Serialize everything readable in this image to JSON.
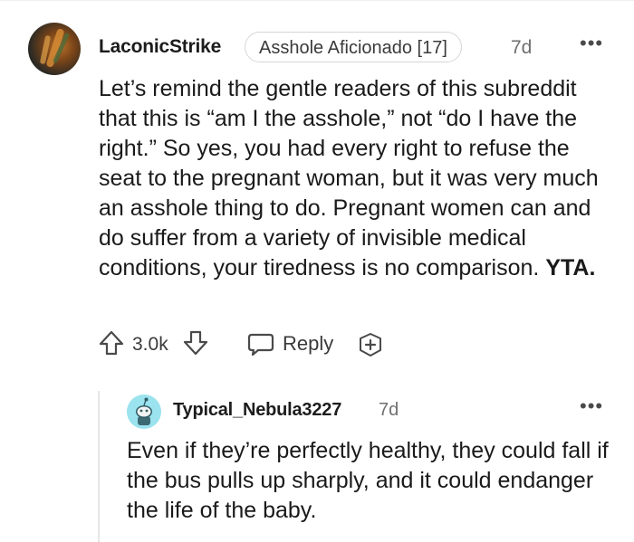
{
  "comment": {
    "username": "LaconicStrike",
    "flair": "Asshole Aficionado [17]",
    "time": "7d",
    "more": "•••",
    "body_text": "Let’s remind the gentle readers of this subreddit that this is “am I the asshole,” not “do I have the right.” So yes, you had every right to refuse the seat to the pregnant woman, but it was very much an asshole thing to do. Pregnant women can and do suffer from a variety of invisible medical conditions, your tiredness is no comparison.",
    "body_bold": "YTA.",
    "score": "3.0k",
    "reply_label": "Reply"
  },
  "reply": {
    "username": "Typical_Nebula3227",
    "time": "7d",
    "more": "•••",
    "body_text": "Even if they’re perfectly healthy, they could fall if the bus pulls up sharply, and it could endanger the life of the baby."
  },
  "colors": {
    "text": "#1c1c1c",
    "muted": "#6f6f6f",
    "thread_line": "#e6e6e6",
    "reply_avatar_bg": "#9be3ee"
  },
  "icons": [
    "upvote-icon",
    "downvote-icon",
    "reply-icon",
    "award-icon",
    "more-options-icon"
  ]
}
